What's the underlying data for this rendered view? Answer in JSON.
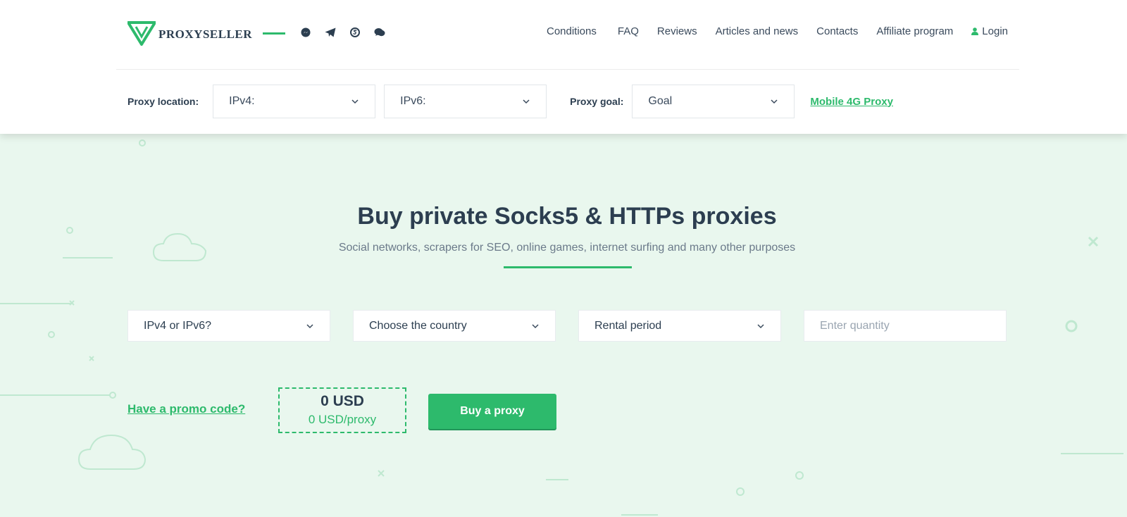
{
  "brand": {
    "name": "PROXYSELLER",
    "accent_color": "#2dba6c",
    "text_color": "#2c3e50",
    "background_color": "#e9f7ee"
  },
  "social_icons": [
    "messenger-icon",
    "telegram-icon",
    "skype-icon",
    "chat-icon"
  ],
  "nav": {
    "items": [
      "Conditions",
      "FAQ",
      "Reviews",
      "Articles and news",
      "Contacts",
      "Affiliate program"
    ],
    "login": "Login"
  },
  "filters": {
    "location_label": "Proxy location:",
    "ipv4_value": "IPv4:",
    "ipv6_value": "IPv6:",
    "goal_label": "Proxy goal:",
    "goal_value": "Goal",
    "mobile_link": "Mobile 4G Proxy"
  },
  "hero": {
    "title": "Buy private Socks5 & HTTPs proxies",
    "subtitle": "Social networks, scrapers for SEO, online games, internet surfing and many other purposes"
  },
  "order": {
    "ip_version_value": "IPv4 or IPv6?",
    "country_value": "Choose the country",
    "period_value": "Rental period",
    "quantity_placeholder": "Enter quantity",
    "promo_link": "Have a promo code?",
    "price_total": "0 USD",
    "price_per": "0 USD/proxy",
    "buy_button": "Buy a proxy"
  }
}
